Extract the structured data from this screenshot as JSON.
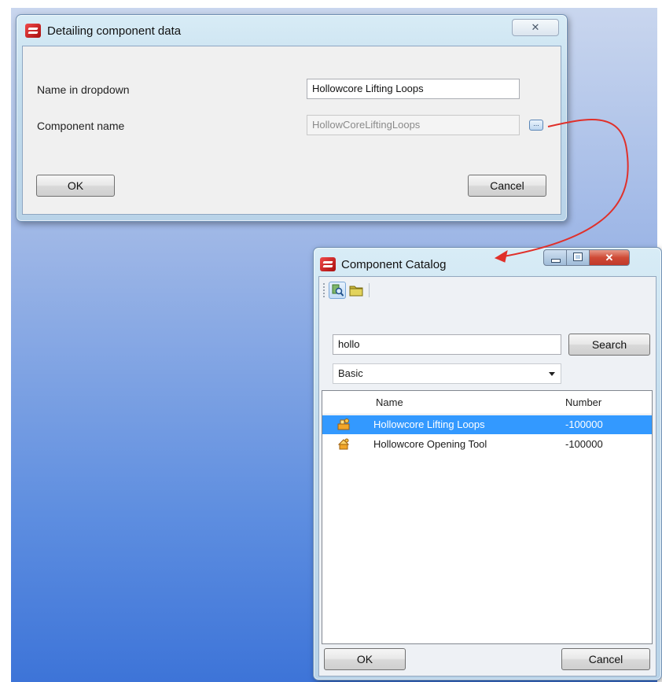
{
  "detailing_dialog": {
    "title": "Detailing component data",
    "close_glyph": "✕",
    "name_in_dropdown_label": "Name in dropdown",
    "name_in_dropdown_value": "Hollowcore Lifting Loops",
    "component_name_label": "Component name",
    "component_name_value": "HollowCoreLiftingLoops",
    "browse_button_label": "...",
    "ok_label": "OK",
    "cancel_label": "Cancel"
  },
  "catalog_dialog": {
    "title": "Component Catalog",
    "close_glyph": "✕",
    "toolbar": {
      "icons": [
        "search-icon",
        "folder-icon"
      ]
    },
    "search_value": "hollo",
    "search_button_label": "Search",
    "category_selected": "Basic",
    "columns": {
      "name": "Name",
      "number": "Number"
    },
    "rows": [
      {
        "name": "Hollowcore Lifting Loops",
        "number": "-100000",
        "selected": true,
        "icon": "component-icon"
      },
      {
        "name": "Hollowcore Opening Tool",
        "number": "-100000",
        "selected": false,
        "icon": "component-icon"
      }
    ],
    "ok_label": "OK",
    "cancel_label": "Cancel"
  },
  "colors": {
    "selection": "#3399ff",
    "annotation_arrow": "#e0302a",
    "title_red_icon": "#d42020"
  }
}
